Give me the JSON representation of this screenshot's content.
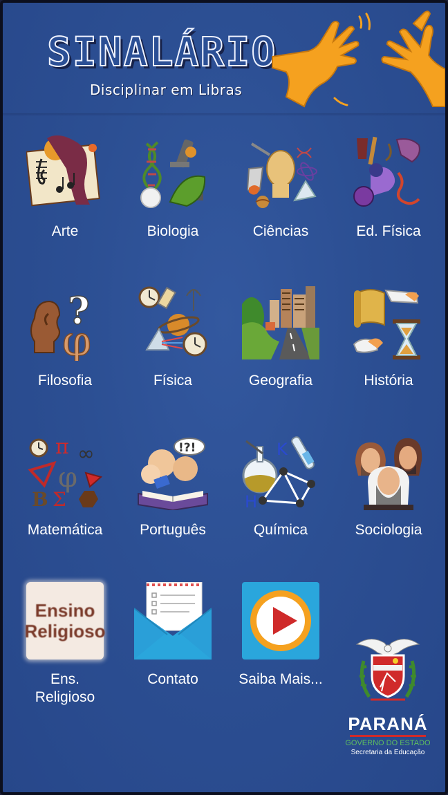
{
  "header": {
    "title": "SINALÁRIO",
    "subtitle": "Disciplinar em Libras"
  },
  "subjects": [
    {
      "label": "Arte",
      "icon": "art-icon"
    },
    {
      "label": "Biologia",
      "icon": "biology-icon"
    },
    {
      "label": "Ciências",
      "icon": "sciences-icon"
    },
    {
      "label": "Ed. Física",
      "icon": "physical-education-icon"
    },
    {
      "label": "Filosofia",
      "icon": "philosophy-icon"
    },
    {
      "label": "Física",
      "icon": "physics-icon"
    },
    {
      "label": "Geografia",
      "icon": "geography-icon"
    },
    {
      "label": "História",
      "icon": "history-icon"
    },
    {
      "label": "Matemática",
      "icon": "math-icon"
    },
    {
      "label": "Português",
      "icon": "portuguese-icon"
    },
    {
      "label": "Química",
      "icon": "chemistry-icon"
    },
    {
      "label": "Sociologia",
      "icon": "sociology-icon"
    }
  ],
  "bottom": {
    "religion": {
      "label_line1": "Ens.",
      "label_line2": "Religioso",
      "icon_line1": "Ensino",
      "icon_line2": "Religioso",
      "icon": "religious-education-icon"
    },
    "contact": {
      "label": "Contato",
      "icon": "envelope-icon"
    },
    "more": {
      "label": "Saiba Mais...",
      "icon": "play-icon"
    }
  },
  "seal": {
    "state": "PARANÁ",
    "government": "GOVERNO DO ESTADO",
    "secretariat": "Secretaria da Educação"
  },
  "colors": {
    "background": "#2c4f93",
    "hand": "#f5a11f",
    "play_ring": "#f5a11f",
    "play_arrow": "#cf2a2a",
    "envelope": "#2aa6dc"
  }
}
